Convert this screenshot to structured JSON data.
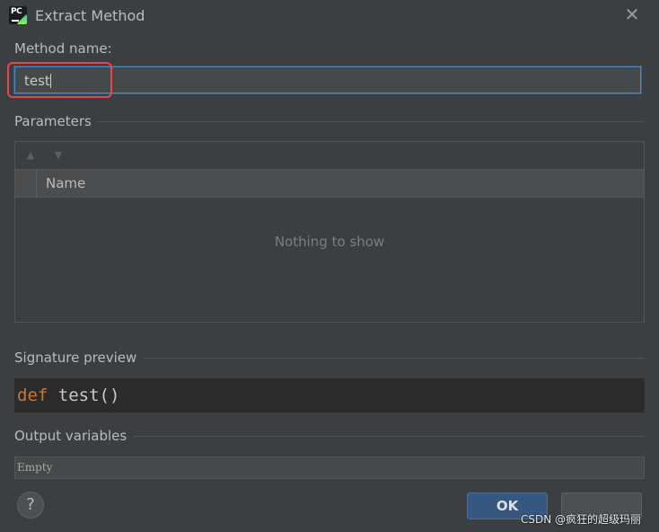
{
  "window": {
    "app_icon_text": "PC",
    "title": "Extract Method",
    "close_glyph": "✕",
    "icons": {
      "app": "pycharm-icon",
      "close": "close-icon"
    }
  },
  "method_name": {
    "label": "Method name:",
    "value": "test"
  },
  "parameters": {
    "label": "Parameters",
    "toolbar": {
      "move_up": "▲",
      "move_down": "▼"
    },
    "columns": [
      "Name"
    ],
    "empty_text": "Nothing to show"
  },
  "signature_preview": {
    "label": "Signature preview",
    "keyword": "def",
    "signature": " test()"
  },
  "output_variables": {
    "label": "Output variables",
    "value": "Empty"
  },
  "buttons": {
    "help": "?",
    "ok": "OK",
    "cancel": ""
  },
  "watermark": "CSDN @疯狂的超级玛丽",
  "colors": {
    "background": "#3c3f41",
    "focus_border": "#4a88c7",
    "keyword": "#cc7832",
    "ok_button": "#365880",
    "highlight": "#e8454d"
  }
}
